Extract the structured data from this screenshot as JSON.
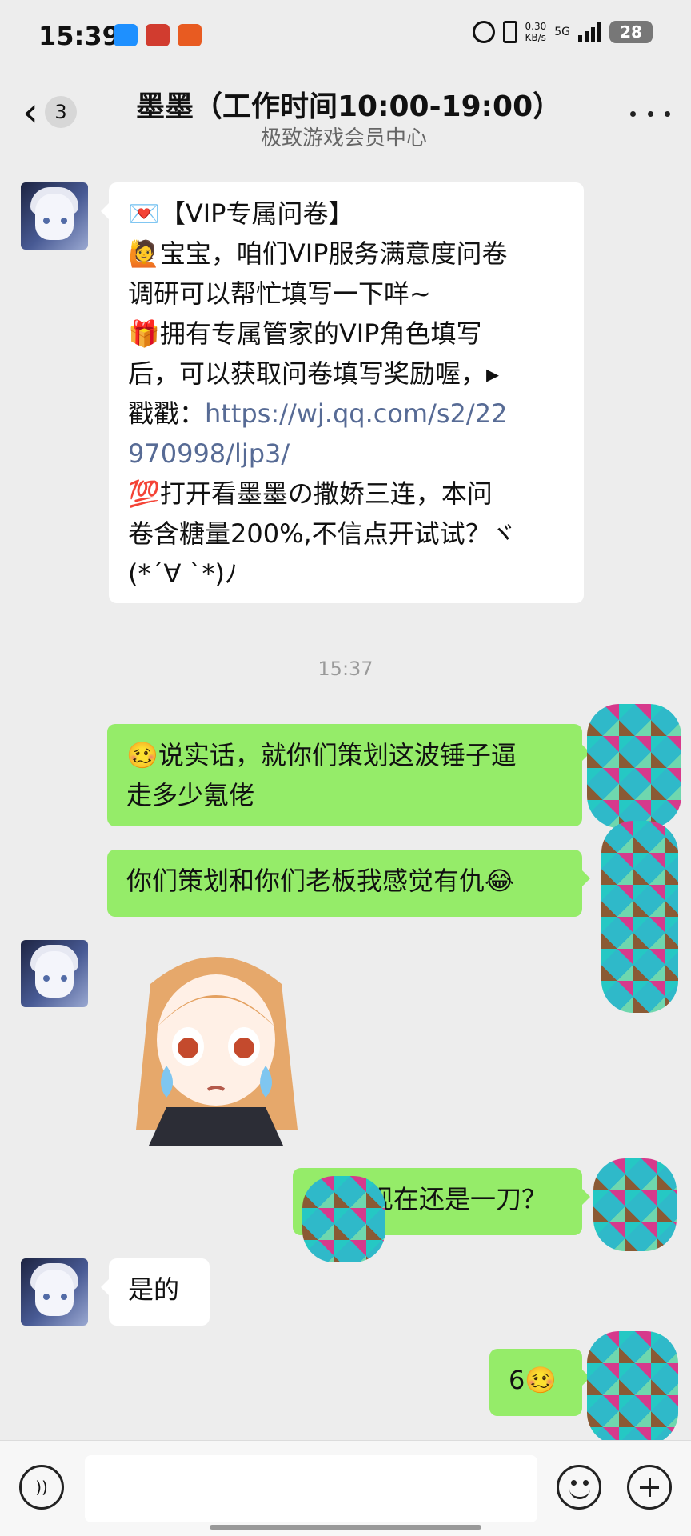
{
  "status_bar": {
    "time": "15:39",
    "network_speed": "0.30\nKB/s",
    "network_type": "5G",
    "battery": "28",
    "icons": [
      "notification-icon",
      "gift-icon",
      "shop-icon",
      "alarm-icon",
      "vibrate-icon"
    ]
  },
  "header": {
    "back_count": "3",
    "title": "墨墨（工作时间10:00-19:00）",
    "subtitle": "极致游戏会员中心"
  },
  "messages": {
    "m1_lines": [
      "💌【VIP专属问卷】",
      "🙋宝宝，咱们VIP服务满意度问卷",
      "调研可以帮忙填写一下咩~",
      "🎁拥有专属管家的VIP角色填写",
      "后，可以获取问卷填写奖励喔，▸",
      "戳戳：",
      "https://wj.qq.com/s2/22",
      "970998/ljp3/",
      "💯打开看墨墨の撒娇三连，本问",
      "卷含糖量200%,不信点开试试？ヾ",
      "(*´∀ `*)ﾉ"
    ],
    "timestamp": "15:37",
    "m2_lines": [
      "🥴说实话，就你们策划这波锤子逼",
      "走多少氪佬"
    ],
    "m3": "你们策划和你们老板我感觉有仇😂",
    "m4_visible": "现在还是一刀？",
    "m5": "是的",
    "m6": "6🥴"
  },
  "colors": {
    "background": "#ededed",
    "right_bubble": "#95ec69",
    "link": "#576b95"
  }
}
